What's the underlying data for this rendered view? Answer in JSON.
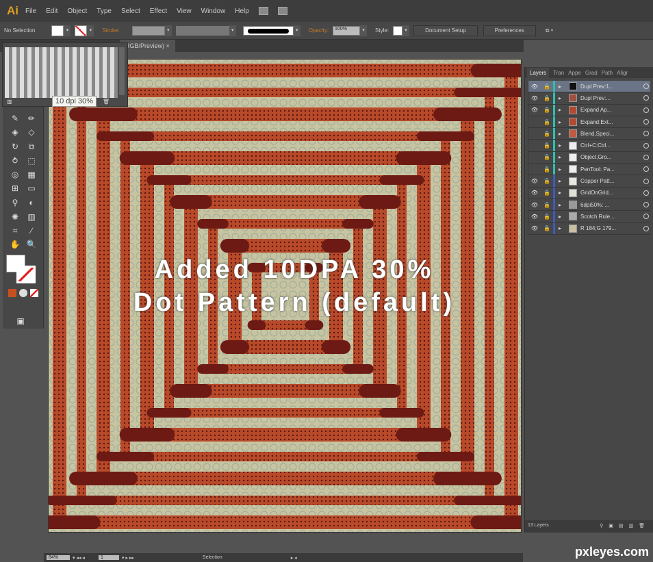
{
  "app": {
    "logo": "Ai",
    "menu": [
      "File",
      "Edit",
      "Object",
      "Type",
      "Select",
      "Effect",
      "View",
      "Window",
      "Help"
    ]
  },
  "control": {
    "selection": "No Selection",
    "stroke_label": "Stroke:",
    "opacity_label": "Opacity:",
    "opacity_value": "100%",
    "style_label": "Style:",
    "document_setup": "Document Setup",
    "preferences": "Preferences"
  },
  "document_tab": {
    "title": "RGB/Preview)",
    "close": "×"
  },
  "swatches": {
    "tooltip": "10 dpi 30%"
  },
  "artwork": {
    "overlay_line1": "Added 10DPA 30%",
    "overlay_line2": "Dot Pattern (default)",
    "colors": {
      "background": "#c9c4a0",
      "bar": "#b84a2a",
      "dark_bar": "#6e1a14"
    }
  },
  "layers_panel": {
    "tabs": [
      "Layers",
      "Tran",
      "Appe",
      "Grad",
      "Path",
      "Aligr"
    ],
    "layers": [
      {
        "name": "Dupl Prev:1...",
        "visible": true,
        "color": "#2cc0b0",
        "thumb": "#111",
        "selected": true
      },
      {
        "name": "Dupl Prev:...",
        "visible": true,
        "color": "#2cc0b0",
        "thumb": "#a05040"
      },
      {
        "name": "Expand Ap...",
        "visible": true,
        "color": "#2cc0b0",
        "thumb": "#b04a30"
      },
      {
        "name": "Expand:Ext...",
        "visible": false,
        "color": "#2cc0b0",
        "thumb": "#b04a30"
      },
      {
        "name": "Blend,Speci...",
        "visible": false,
        "color": "#2cc0b0",
        "thumb": "#c05a40"
      },
      {
        "name": "Ctrl+C:Ctrl...",
        "visible": false,
        "color": "#2cc0b0",
        "thumb": "#eee"
      },
      {
        "name": "Object,Gro...",
        "visible": false,
        "color": "#2cc0b0",
        "thumb": "#eee"
      },
      {
        "name": "PenTool: Pa...",
        "visible": false,
        "color": "#2cc0b0",
        "thumb": "#eee"
      },
      {
        "name": "Copper Patt...",
        "visible": true,
        "color": "#3a5cc0",
        "thumb": "#e8e8e0"
      },
      {
        "name": "GridOnGrid...",
        "visible": true,
        "color": "#3a5cc0",
        "thumb": "#e0e0d8"
      },
      {
        "name": "6dpi50%: ...",
        "visible": true,
        "color": "#3a5cc0",
        "thumb": "#999"
      },
      {
        "name": "Scotch Rule...",
        "visible": true,
        "color": "#3a5cc0",
        "thumb": "#aaa"
      },
      {
        "name": "R 184;G 179...",
        "visible": true,
        "color": "#3a5cc0",
        "thumb": "#c8c0a0"
      }
    ],
    "count": "13 Layers"
  },
  "status": {
    "zoom": "84%",
    "artboard": "1",
    "tool": "Selection"
  },
  "watermark": "pxleyes.com"
}
